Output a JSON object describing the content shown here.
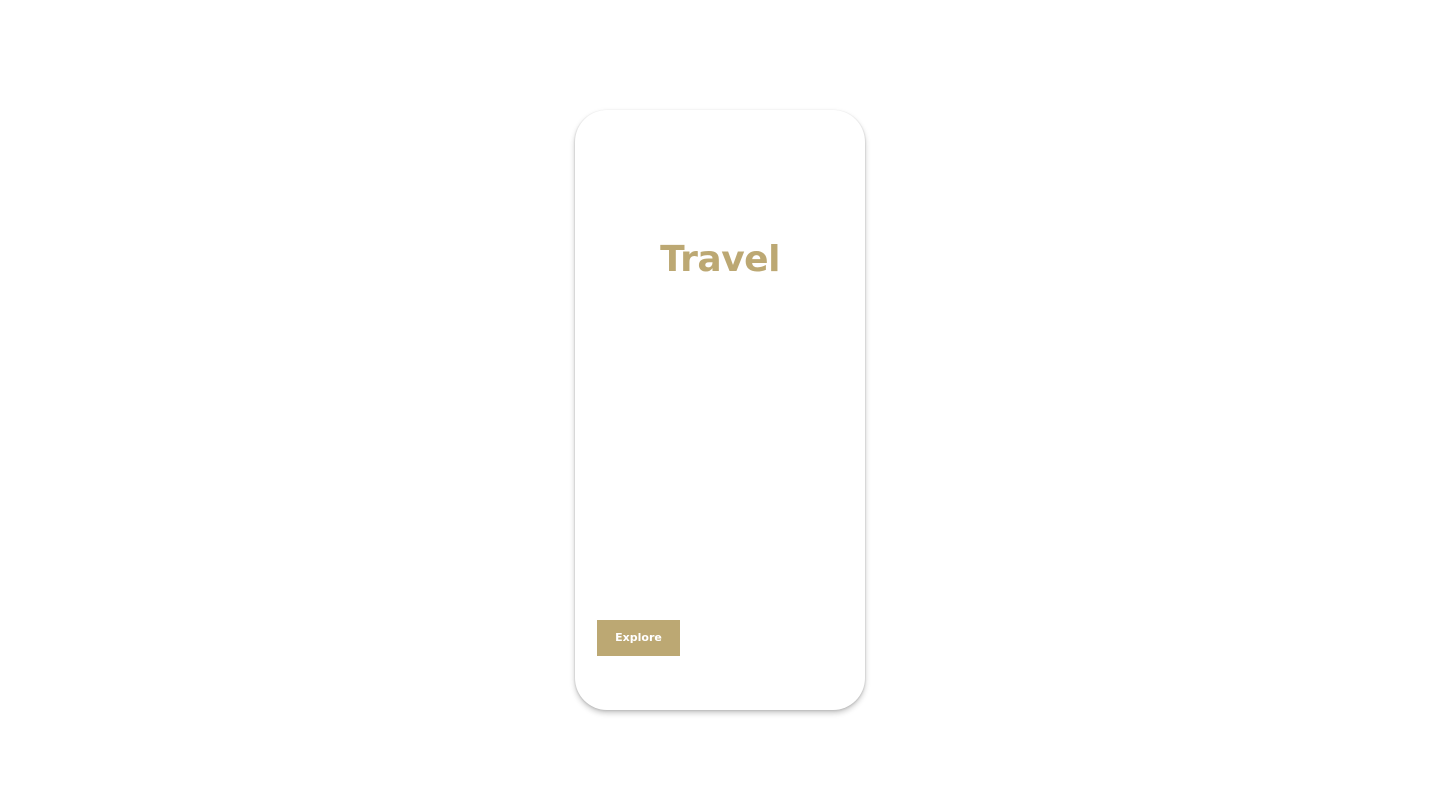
{
  "screen": {
    "title": "Travel",
    "explore_label": "Explore"
  },
  "colors": {
    "accent": "#bca873",
    "background": "#ffffff",
    "button_text": "#ffffff"
  }
}
